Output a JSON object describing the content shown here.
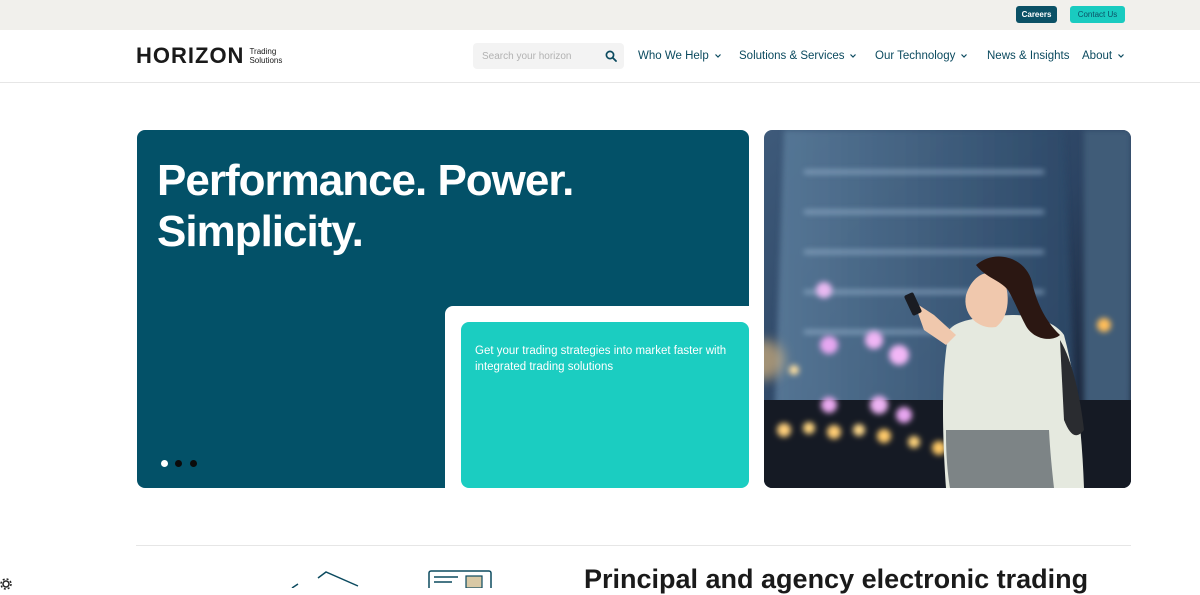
{
  "topbar": {
    "careers_label": "Careers",
    "contact_label": "Contact Us"
  },
  "header": {
    "logo_word": "HORIZON",
    "logo_sub_1": "Trading",
    "logo_sub_2": "Solutions",
    "search": {
      "placeholder": "Search your horizon",
      "value": "",
      "icon": "search-icon"
    },
    "nav": [
      {
        "label": "Who We Help",
        "dropdown": true
      },
      {
        "label": "Solutions & Services",
        "dropdown": true
      },
      {
        "label": "Our Technology",
        "dropdown": true
      },
      {
        "label": "News & Insights",
        "dropdown": false
      },
      {
        "label": "About",
        "dropdown": true
      }
    ]
  },
  "hero": {
    "title_line1": "Performance. Power.",
    "title_line2": "Simplicity.",
    "tagline": "Get your trading strategies into market faster with integrated trading solutions",
    "carousel": {
      "slides": 3,
      "active": 1
    },
    "image": "woman-with-phone-city-night-photo"
  },
  "section": {
    "heading": "Principal and agency electronic trading"
  },
  "colors": {
    "primary_dark": "#035168",
    "accent_teal": "#1bcdc1",
    "careers_bg": "#0b5166",
    "topbar_bg": "#f1f0ec",
    "nav_text": "#0b4a5f"
  }
}
